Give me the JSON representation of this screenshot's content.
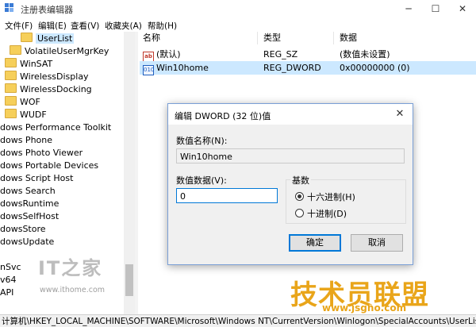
{
  "window": {
    "title": "注册表编辑器",
    "min": "─",
    "max": "☐",
    "close": "✕"
  },
  "menu": [
    "文件(F)",
    "编辑(E)",
    "查看(V)",
    "收藏夹(A)",
    "帮助(H)"
  ],
  "tree": [
    {
      "label": "UserList",
      "folder": true,
      "selected": true
    },
    {
      "label": "VolatileUserMgrKey",
      "folder": true
    },
    {
      "label": "WinSAT",
      "folder": true
    },
    {
      "label": "WirelessDisplay",
      "folder": true
    },
    {
      "label": "WirelessDocking",
      "folder": true
    },
    {
      "label": "WOF",
      "folder": true
    },
    {
      "label": "WUDF",
      "folder": true
    },
    {
      "label": "dows Performance Toolkit"
    },
    {
      "label": "dows Phone"
    },
    {
      "label": "dows Photo Viewer"
    },
    {
      "label": "dows Portable Devices"
    },
    {
      "label": "dows Script Host"
    },
    {
      "label": "dows Search"
    },
    {
      "label": "dowsRuntime"
    },
    {
      "label": "dowsSelfHost"
    },
    {
      "label": "dowsStore"
    },
    {
      "label": "dowsUpdate"
    },
    {
      "label": ""
    },
    {
      "label": "nSvc"
    },
    {
      "label": "v64"
    },
    {
      "label": "API"
    }
  ],
  "list": {
    "headers": {
      "name": "名称",
      "type": "类型",
      "data": "数据"
    },
    "rows": [
      {
        "icon": "ab",
        "name": "(默认)",
        "type": "REG_SZ",
        "data": "(数值未设置)"
      },
      {
        "icon": "010",
        "name": "Win10home",
        "type": "REG_DWORD",
        "data": "0x00000000 (0)",
        "selected": true
      }
    ]
  },
  "dialog": {
    "title": "编辑 DWORD (32 位)值",
    "close": "✕",
    "name_label": "数值名称(N):",
    "name_value": "Win10home",
    "data_label": "数值数据(V):",
    "data_value": "0",
    "base_label": "基数",
    "hex_label": "十六进制(H)",
    "dec_label": "十进制(D)",
    "base_selected": "hex",
    "ok": "确定",
    "cancel": "取消"
  },
  "status": "计算机\\HKEY_LOCAL_MACHINE\\SOFTWARE\\Microsoft\\Windows NT\\CurrentVersion\\Winlogon\\SpecialAccounts\\UserList",
  "watermarks": {
    "ithome": "IT之家",
    "ithome_url": "www.ithome.com",
    "jsgho": "技术员联盟",
    "jsgho_url": "www.jsgho.com"
  }
}
